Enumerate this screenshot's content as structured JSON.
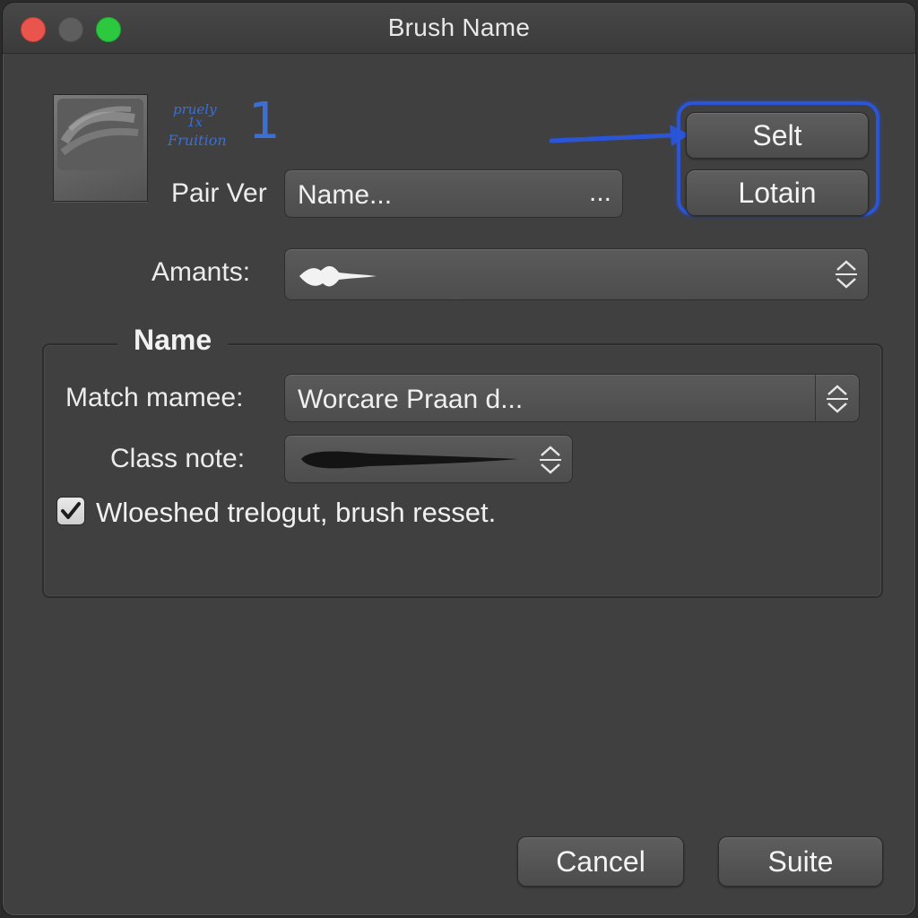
{
  "window": {
    "title": "Brush Name"
  },
  "preview": {
    "handwriting": [
      "pruely",
      "1x",
      "Fruition"
    ],
    "number": "1"
  },
  "pair_ver": {
    "label": "Pair Ver",
    "value": "Name...",
    "ellipsis": "..."
  },
  "side_buttons": {
    "select_label": "Selt",
    "locate_label": "Lotain"
  },
  "amounts": {
    "label": "Amants:",
    "icon": "brush-stroke-icon"
  },
  "group": {
    "title": "Name",
    "match_name": {
      "label": "Match mamee:",
      "value": "Worcare Praan d..."
    },
    "class_note": {
      "label": "Class note:",
      "icon": "brush-stroke-icon"
    },
    "checkbox": {
      "label": "Wloeshed trelogut, brush resset.",
      "checked": true
    }
  },
  "footer": {
    "cancel_label": "Cancel",
    "confirm_label": "Suite"
  },
  "colors": {
    "accent": "#2a55d8",
    "background": "#404040"
  }
}
